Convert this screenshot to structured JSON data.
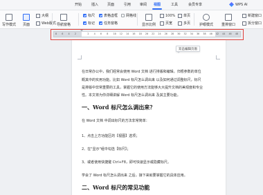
{
  "tabs": [
    "开始",
    "插入",
    "页面",
    "引用",
    "审阅",
    "视图",
    "工具",
    "会员专享"
  ],
  "active_tab": "视图",
  "ai_label": "WPS AI",
  "ribbon": {
    "write_mode": "写作模式",
    "page": "页面",
    "outline": "大纲",
    "web_layout": "Web版式",
    "nav_pane": "导航窗格",
    "ruler": "标尺",
    "table_gridlines": "表格虚框",
    "gridlines": "网格线",
    "markup": "标记",
    "task_pane": "任务窗格",
    "show_ratio": "显示比例",
    "zoom_100": "100%",
    "single_page": "单页",
    "multi_page": "多页",
    "page_width": "页宽",
    "eye_mode": "护眼模式",
    "rearrange_window": "重排窗口",
    "new_window": "新建窗口",
    "split_window": "拆分窗口"
  },
  "ruler": {
    "ticks": [
      "8",
      "6",
      "4",
      "2",
      "",
      "2",
      "4",
      "6",
      "8",
      "10",
      "12",
      "14",
      "16",
      "18",
      "20",
      "22",
      "24",
      "26",
      "28",
      "30",
      "32",
      "34",
      "36",
      "38",
      "40",
      "42",
      "44",
      "46",
      "48"
    ],
    "tooltip": "双击编辑页眉"
  },
  "document": {
    "p1": "在日常办公中，我们经常会使用 Word 文档 进行排版和编辑。归根参数的单位",
    "p2": "概其中的实用功能。比如 Word 标尺怎么调出来 以及如何通过调整标尺，标尺",
    "p3": "是排版中非常重要的工具，掌握它的使用方法能够大大提升文档的美观度和专业",
    "p4": "性。本文将为你详细讲解 Word 标尺怎么调出来 及其主要功能。",
    "h1": "一、Word 标尺怎么调出来？",
    "p5": "在 Word 文档 中调出标尺的方法非常简单：",
    "s1": "1、点击上方功能区的【视图】选项；",
    "s2": "2、在\"显示\"组中勾选【标尺】；",
    "s3": "3、或者使用快捷键 Ctrl+F8，即可快速显示或隐藏标尺。",
    "p6": "学会了 Word 标尺怎么调出来 之后，接下来就要掌握它的具体应用。",
    "h2": "二、Word 标尺的常见功能"
  }
}
